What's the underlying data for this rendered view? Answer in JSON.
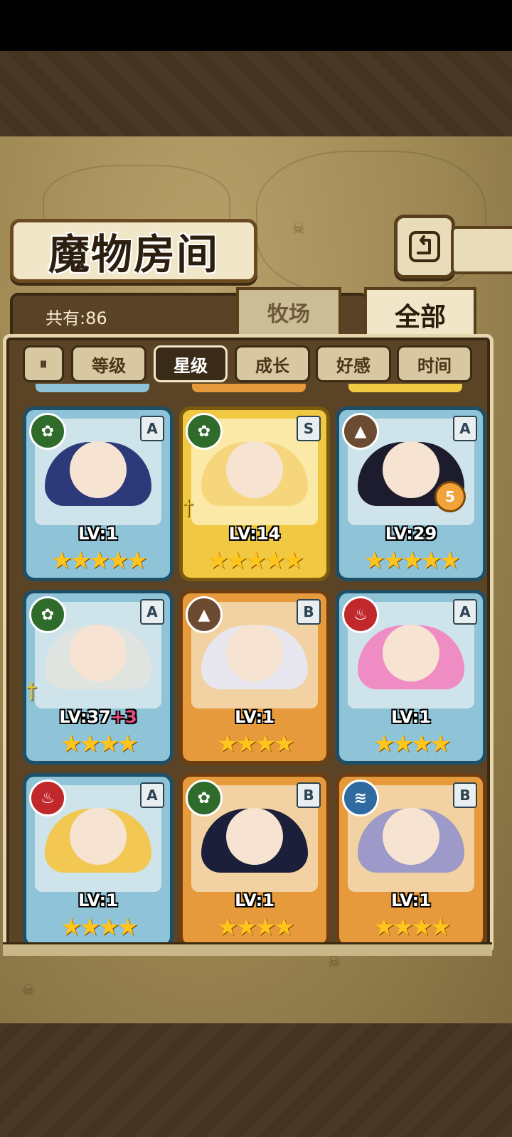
{
  "title": "魔物房间",
  "count_text": "共有:86",
  "tabs": {
    "ranch": "牧场",
    "all": "全部"
  },
  "sort": {
    "toggle": "⏸",
    "items": [
      "等级",
      "星级",
      "成长",
      "好感",
      "时间"
    ],
    "active": "星级"
  },
  "back_icon": "return-arrow-icon",
  "cards": [
    {
      "level": "LV:1",
      "rank": "A",
      "element": "grass",
      "frame": "blue",
      "stars": 5,
      "hair": "#2d3a7a"
    },
    {
      "level": "LV:14",
      "rank": "S",
      "element": "grass",
      "frame": "gold",
      "stars": 5,
      "hair": "#f5d67c",
      "weapon": true
    },
    {
      "level": "LV:29",
      "rank": "A",
      "element": "rock",
      "frame": "blue",
      "stars": 5,
      "hair": "#1d1b2e",
      "badge": "5"
    },
    {
      "level": "LV:37",
      "plus": "+3",
      "rank": "A",
      "element": "grass",
      "frame": "blue",
      "stars": 4,
      "hair": "#e0e4e0",
      "weapon": true
    },
    {
      "level": "LV:1",
      "rank": "B",
      "element": "rock",
      "frame": "orange",
      "stars": 4,
      "hair": "#e8e6ee"
    },
    {
      "level": "LV:1",
      "rank": "A",
      "element": "fire",
      "frame": "blue",
      "stars": 4,
      "hair": "#f08cc4"
    },
    {
      "level": "LV:1",
      "rank": "A",
      "element": "fire",
      "frame": "blue",
      "stars": 4,
      "hair": "#f2c752"
    },
    {
      "level": "LV:1",
      "rank": "B",
      "element": "grass",
      "frame": "orange",
      "stars": 4,
      "hair": "#1b1f3a"
    },
    {
      "level": "LV:1",
      "rank": "B",
      "element": "water",
      "frame": "orange",
      "stars": 4,
      "hair": "#9d99c8"
    }
  ]
}
